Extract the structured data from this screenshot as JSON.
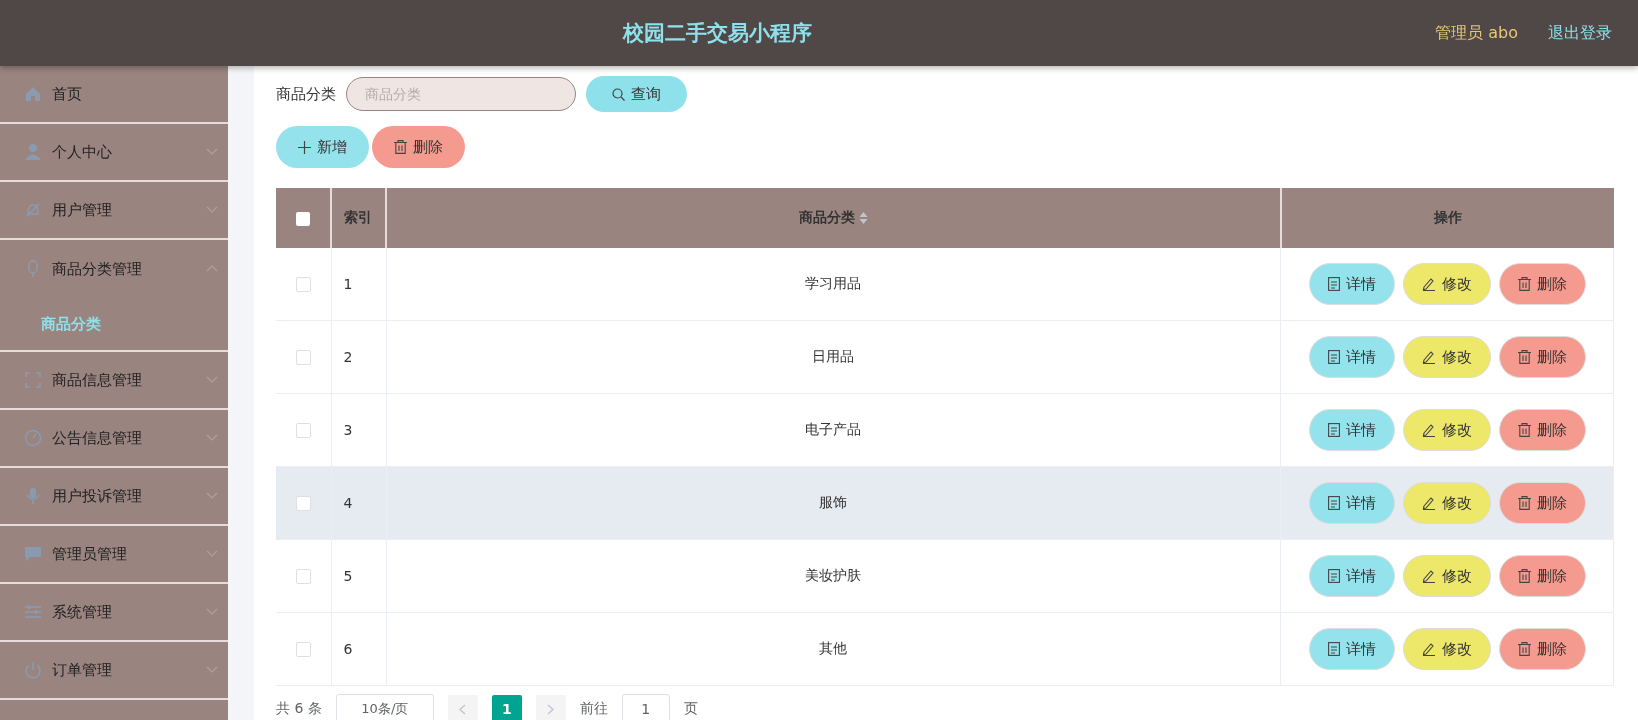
{
  "header": {
    "title": "校园二手交易小程序",
    "user": "管理员 abo",
    "logout": "退出登录"
  },
  "sidebar": {
    "items": [
      {
        "label": "首页",
        "expandable": false
      },
      {
        "label": "个人中心",
        "expandable": true,
        "expanded": false
      },
      {
        "label": "用户管理",
        "expandable": true,
        "expanded": false
      },
      {
        "label": "商品分类管理",
        "expandable": true,
        "expanded": true,
        "children": [
          {
            "label": "商品分类",
            "selected": true
          }
        ]
      },
      {
        "label": "商品信息管理",
        "expandable": true,
        "expanded": false
      },
      {
        "label": "公告信息管理",
        "expandable": true,
        "expanded": false
      },
      {
        "label": "用户投诉管理",
        "expandable": true,
        "expanded": false
      },
      {
        "label": "管理员管理",
        "expandable": true,
        "expanded": false
      },
      {
        "label": "系统管理",
        "expandable": true,
        "expanded": false
      },
      {
        "label": "订单管理",
        "expandable": true,
        "expanded": false
      }
    ]
  },
  "search": {
    "label": "商品分类",
    "placeholder": "商品分类",
    "button": "查询"
  },
  "actions": [
    {
      "label": "新增",
      "kind": "add"
    },
    {
      "label": "删除",
      "kind": "delete"
    }
  ],
  "table": {
    "columns": [
      "索引",
      "商品分类",
      "操作"
    ],
    "all_checked": false,
    "rows": [
      {
        "index": "1",
        "category": "学习用品",
        "checked": false,
        "highlighted": false,
        "actions": [
          {
            "label": "详情",
            "kind": "detail"
          },
          {
            "label": "修改",
            "kind": "edit"
          },
          {
            "label": "删除",
            "kind": "delete"
          }
        ]
      },
      {
        "index": "2",
        "category": "日用品",
        "checked": false,
        "highlighted": false,
        "actions": [
          {
            "label": "详情",
            "kind": "detail"
          },
          {
            "label": "修改",
            "kind": "edit"
          },
          {
            "label": "删除",
            "kind": "delete"
          }
        ]
      },
      {
        "index": "3",
        "category": "电子产品",
        "checked": false,
        "highlighted": false,
        "actions": [
          {
            "label": "详情",
            "kind": "detail"
          },
          {
            "label": "修改",
            "kind": "edit"
          },
          {
            "label": "删除",
            "kind": "delete"
          }
        ]
      },
      {
        "index": "4",
        "category": "服饰",
        "checked": false,
        "highlighted": true,
        "actions": [
          {
            "label": "详情",
            "kind": "detail"
          },
          {
            "label": "修改",
            "kind": "edit"
          },
          {
            "label": "删除",
            "kind": "delete"
          }
        ]
      },
      {
        "index": "5",
        "category": "美妆护肤",
        "checked": false,
        "highlighted": false,
        "actions": [
          {
            "label": "详情",
            "kind": "detail"
          },
          {
            "label": "修改",
            "kind": "edit"
          },
          {
            "label": "删除",
            "kind": "delete"
          }
        ]
      },
      {
        "index": "6",
        "category": "其他",
        "checked": false,
        "highlighted": false,
        "actions": [
          {
            "label": "详情",
            "kind": "detail"
          },
          {
            "label": "修改",
            "kind": "edit"
          },
          {
            "label": "删除",
            "kind": "delete"
          }
        ]
      }
    ]
  },
  "pagination": {
    "total": "共 6 条",
    "page_size": "10条/页",
    "pages": [
      {
        "label": "1",
        "selected": true
      }
    ],
    "goto_label": "前往",
    "goto_value": "1",
    "goto_suffix": "页"
  }
}
